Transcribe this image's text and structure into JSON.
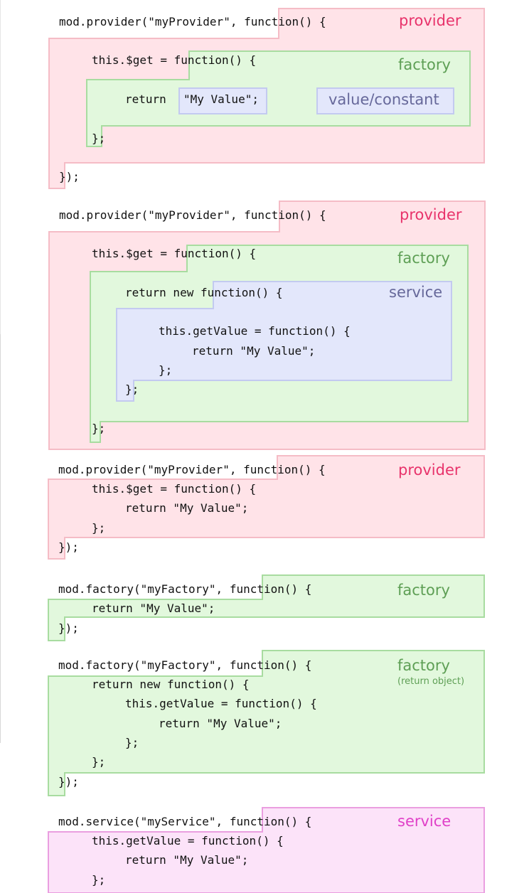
{
  "colors": {
    "provider_fill": "#ffe3e8",
    "provider_stroke": "#f5bcc6",
    "provider_label": "#e8336b",
    "factory_fill": "#e2f8dd",
    "factory_stroke": "#a8dca0",
    "factory_label": "#5e9f55",
    "service_fill": "#e3e7fb",
    "service_stroke": "#c3caf0",
    "service_label": "#66689a",
    "service2_fill": "#fce3f9",
    "service2_stroke": "#ea9ee0",
    "service2_label": "#e040c8"
  },
  "labels": {
    "provider": "provider",
    "factory": "factory",
    "value_constant": "value/constant",
    "service": "service",
    "return_object": "(return object)"
  },
  "code": {
    "d1": {
      "l1": "mod.provider(\"myProvider\", function() {",
      "l2": "this.$get = function() {",
      "l3a": "return ",
      "l3b": "\"My Value\";",
      "l4": "};",
      "l5": "});"
    },
    "d2": {
      "l1": "mod.provider(\"myProvider\", function() {",
      "l2": "this.$get = function() {",
      "l3": "return new function() {",
      "l4": "this.getValue = function() {",
      "l5": "return \"My Value\";",
      "l6": "};",
      "l7": "};",
      "l8": "};"
    },
    "d3": {
      "l1": "mod.provider(\"myProvider\", function() {",
      "l2": "this.$get = function() {",
      "l3": "return \"My Value\";",
      "l4": "};",
      "l5": "});"
    },
    "d4": {
      "l1": "mod.factory(\"myFactory\", function() {",
      "l2": "return \"My Value\";",
      "l3": "});"
    },
    "d5": {
      "l1": "mod.factory(\"myFactory\", function() {",
      "l2": "return new function() {",
      "l3": "this.getValue = function() {",
      "l4": "return \"My Value\";",
      "l5": "};",
      "l6": "};",
      "l7": "});"
    },
    "d6": {
      "l1": "mod.service(\"myService\", function() {",
      "l2": "this.getValue = function() {",
      "l3": "return \"My Value\";",
      "l4": "};"
    }
  }
}
